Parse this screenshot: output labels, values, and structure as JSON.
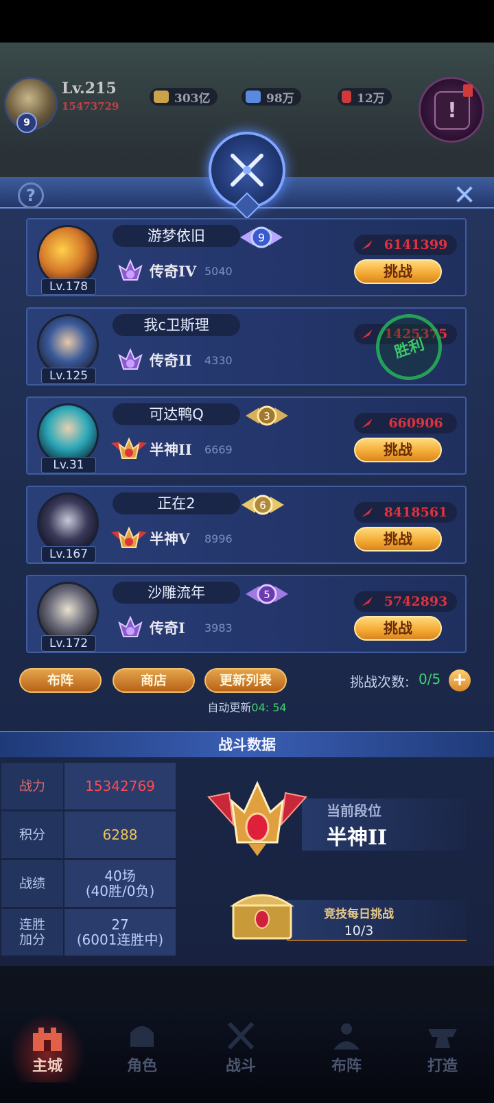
{
  "hud": {
    "level": "Lv.215",
    "power": "15473729",
    "vip": "9",
    "resources": [
      {
        "label": "303亿",
        "icon": "gold-icon",
        "color": "#caa24a"
      },
      {
        "label": "98万",
        "icon": "gem-icon",
        "color": "#5a8ae0"
      },
      {
        "label": "12万",
        "icon": "ruby-icon",
        "color": "#d03a3a"
      }
    ]
  },
  "panel": {
    "help_symbol": "?",
    "close_symbol": "✕"
  },
  "opponents": [
    {
      "name": "游梦依旧",
      "level": "Lv.178",
      "rank": "传奇IV",
      "points": "5040",
      "power": "6141399",
      "action": "挑战",
      "badge": "9",
      "defeated": false
    },
    {
      "name": "我c卫斯理",
      "level": "Lv.125",
      "rank": "传奇II",
      "points": "4330",
      "power": "1425375",
      "action": "",
      "badge": "",
      "defeated": true
    },
    {
      "name": "可达鸭Q",
      "level": "Lv.31",
      "rank": "半神II",
      "points": "6669",
      "power": "660906",
      "action": "挑战",
      "badge": "3",
      "defeated": false
    },
    {
      "name": "正在2",
      "level": "Lv.167",
      "rank": "半神V",
      "points": "8996",
      "power": "8418561",
      "action": "挑战",
      "badge": "6",
      "defeated": false
    },
    {
      "name": "沙雕流年",
      "level": "Lv.172",
      "rank": "传奇I",
      "points": "3983",
      "power": "5742893",
      "action": "挑战",
      "badge": "5",
      "defeated": false
    }
  ],
  "victory_stamp": "胜利",
  "actions": {
    "formation": "布阵",
    "shop": "商店",
    "refresh": "更新列表",
    "challenge_label": "挑战次数:",
    "challenge_value": "0/5",
    "auto_refresh_label": "自动更新",
    "auto_refresh_time": "04: 54"
  },
  "stats": {
    "title": "战斗数据",
    "rows": [
      {
        "key": "战力",
        "value": "15342769"
      },
      {
        "key": "积分",
        "value": "6288"
      },
      {
        "key": "战绩",
        "value": "40场",
        "value2": "(40胜/0负)"
      },
      {
        "key": "连胜",
        "key2": "加分",
        "value": "27",
        "value2": "(6001连胜中)"
      }
    ],
    "current_tier_label": "当前段位",
    "current_tier": "半神II",
    "daily_label": "竞技每日挑战",
    "daily_value": "10/3"
  },
  "nav": [
    {
      "label": "主城",
      "active": true
    },
    {
      "label": "角色",
      "active": false
    },
    {
      "label": "战斗",
      "active": false
    },
    {
      "label": "布阵",
      "active": false
    },
    {
      "label": "打造",
      "active": false
    }
  ]
}
